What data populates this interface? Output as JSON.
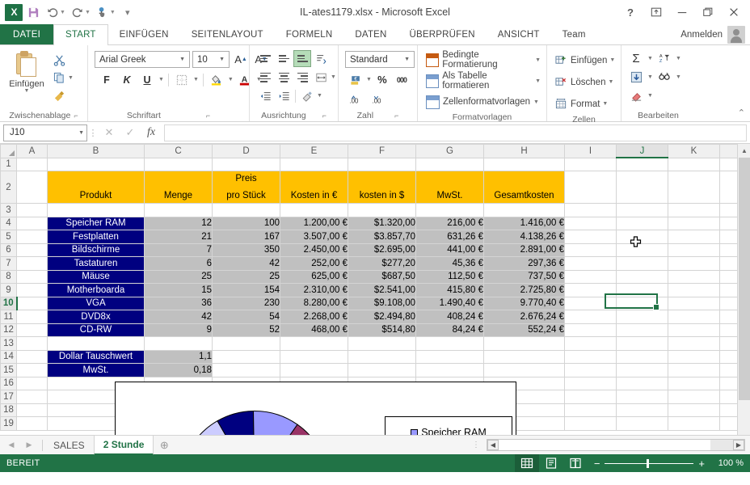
{
  "window": {
    "title": "IL-ates1179.xlsx - Microsoft Excel",
    "help": "?",
    "ribbon_display": "ribbon-display-icon",
    "minimize": "minimize-icon",
    "restore": "restore-icon",
    "close": "close-icon"
  },
  "quick_access": {
    "logo": "excel-logo",
    "save": "save-icon",
    "undo": "undo-icon",
    "redo": "redo-icon",
    "touch": "touch-mode-icon",
    "more": "customize-qat-icon"
  },
  "tabs": [
    {
      "label": "DATEI",
      "type": "file"
    },
    {
      "label": "START",
      "active": true
    },
    {
      "label": "EINFÜGEN"
    },
    {
      "label": "SEITENLAYOUT"
    },
    {
      "label": "FORMELN"
    },
    {
      "label": "DATEN"
    },
    {
      "label": "ÜBERPRÜFEN"
    },
    {
      "label": "ANSICHT"
    },
    {
      "label": "Team"
    }
  ],
  "signin": {
    "label": "Anmelden"
  },
  "ribbon": {
    "clipboard": {
      "group_label": "Zwischenablage",
      "paste_label": "Einfügen",
      "cut": "scissors-icon",
      "copy": "copy-icon",
      "format_painter": "format-painter-icon"
    },
    "font": {
      "group_label": "Schriftart",
      "font_name": "Arial Greek",
      "font_size": "10",
      "grow": "A",
      "shrink": "A",
      "bold": "F",
      "italic": "K",
      "underline": "U",
      "borders": "borders-icon",
      "fill_color": "fill-color-icon",
      "font_color": "A"
    },
    "alignment": {
      "group_label": "Ausrichtung",
      "align_top": "align-top-icon",
      "align_middle": "align-middle-icon",
      "align_bottom": "align-bottom-icon",
      "orientation": "orientation-icon",
      "align_left": "align-left-icon",
      "align_center": "align-center-icon",
      "align_right": "align-right-icon",
      "wrap_text": "wrap-text-icon",
      "decrease_indent": "decrease-indent-icon",
      "increase_indent": "increase-indent-icon",
      "merge": "merge-cells-icon"
    },
    "number": {
      "group_label": "Zahl",
      "format": "Standard",
      "currency": "currency-icon",
      "percent": "%",
      "comma": "000",
      "increase_decimal": "increase-decimal-icon",
      "decrease_decimal": "decrease-decimal-icon"
    },
    "styles": {
      "group_label": "Formatvorlagen",
      "items": [
        {
          "label": "Bedingte Formatierung"
        },
        {
          "label": "Als Tabelle formatieren"
        },
        {
          "label": "Zellenformatvorlagen"
        }
      ]
    },
    "cells": {
      "group_label": "Zellen",
      "items": [
        {
          "label": "Einfügen"
        },
        {
          "label": "Löschen"
        },
        {
          "label": "Format"
        }
      ]
    },
    "editing": {
      "group_label": "Bearbeiten",
      "autosum": "Σ",
      "fill": "fill-down-icon",
      "clear": "clear-icon",
      "sort": "sort-filter-icon",
      "find": "find-select-icon"
    },
    "collapse": "collapse-ribbon-icon"
  },
  "formula_bar": {
    "name_box": "J10",
    "cancel": "cancel-icon",
    "enter": "enter-icon",
    "insert_function": "fx",
    "formula_value": ""
  },
  "grid": {
    "columns": [
      "A",
      "B",
      "C",
      "D",
      "E",
      "F",
      "G",
      "H",
      "I",
      "J",
      "K",
      "L"
    ],
    "selected_column": "J",
    "selected_row": "10",
    "rows": [
      "1",
      "2",
      "3",
      "4",
      "5",
      "6",
      "7",
      "8",
      "9",
      "10",
      "11",
      "12",
      "13",
      "14",
      "15",
      "16",
      "17",
      "18",
      "19"
    ],
    "headers": {
      "title_line1": "Preis",
      "B": "Produkt",
      "C": "Menge",
      "D": "pro Stück",
      "E": "Kosten in €",
      "F": "kosten in $",
      "G": "MwSt.",
      "H": "Gesamtkosten"
    },
    "data": [
      {
        "row": "4",
        "produkt": "Speicher RAM",
        "menge": "12",
        "preis": "100",
        "kosten_eur": "1.200,00 €",
        "kosten_usd": "$1.320,00",
        "mwst": "216,00 €",
        "gesamt": "1.416,00 €"
      },
      {
        "row": "5",
        "produkt": "Festplatten",
        "menge": "21",
        "preis": "167",
        "kosten_eur": "3.507,00 €",
        "kosten_usd": "$3.857,70",
        "mwst": "631,26 €",
        "gesamt": "4.138,26 €"
      },
      {
        "row": "6",
        "produkt": "Bildschirme",
        "menge": "7",
        "preis": "350",
        "kosten_eur": "2.450,00 €",
        "kosten_usd": "$2.695,00",
        "mwst": "441,00 €",
        "gesamt": "2.891,00 €"
      },
      {
        "row": "7",
        "produkt": "Tastaturen",
        "menge": "6",
        "preis": "42",
        "kosten_eur": "252,00 €",
        "kosten_usd": "$277,20",
        "mwst": "45,36 €",
        "gesamt": "297,36 €"
      },
      {
        "row": "8",
        "produkt": "Mäuse",
        "menge": "25",
        "preis": "25",
        "kosten_eur": "625,00 €",
        "kosten_usd": "$687,50",
        "mwst": "112,50 €",
        "gesamt": "737,50 €"
      },
      {
        "row": "9",
        "produkt": "Motherboarda",
        "menge": "15",
        "preis": "154",
        "kosten_eur": "2.310,00 €",
        "kosten_usd": "$2.541,00",
        "mwst": "415,80 €",
        "gesamt": "2.725,80 €"
      },
      {
        "row": "10",
        "produkt": "VGA",
        "menge": "36",
        "preis": "230",
        "kosten_eur": "8.280,00 €",
        "kosten_usd": "$9.108,00",
        "mwst": "1.490,40 €",
        "gesamt": "9.770,40 €"
      },
      {
        "row": "11",
        "produkt": "DVD8x",
        "menge": "42",
        "preis": "54",
        "kosten_eur": "2.268,00 €",
        "kosten_usd": "$2.494,80",
        "mwst": "408,24 €",
        "gesamt": "2.676,24 €"
      },
      {
        "row": "12",
        "produkt": "CD-RW",
        "menge": "9",
        "preis": "52",
        "kosten_eur": "468,00 €",
        "kosten_usd": "$514,80",
        "mwst": "84,24 €",
        "gesamt": "552,24 €"
      }
    ],
    "params": [
      {
        "row": "14",
        "label": "Dollar Tauschwert",
        "value": "1,1"
      },
      {
        "row": "15",
        "label": "MwSt.",
        "value": "0,18"
      }
    ],
    "cursor": "cross-cursor"
  },
  "chart_data": {
    "type": "pie",
    "title": "",
    "legend_position": "right",
    "legend_entries": [
      "Speicher RAM"
    ],
    "categories": [
      "Speicher RAM",
      "Festplatten",
      "Bildschirme",
      "Tastaturen",
      "Mäuse",
      "Motherboarda",
      "VGA",
      "DVD8x",
      "CD-RW"
    ],
    "values": [
      1416.0,
      4138.26,
      2891.0,
      297.36,
      737.5,
      2725.8,
      9770.4,
      2676.24,
      552.24
    ],
    "colors": [
      "#9999FF",
      "#993366",
      "#FFFFCC",
      "#CCFFFF",
      "#660066",
      "#FF8080",
      "#0066CC",
      "#CCCCFF",
      "#000080"
    ],
    "visible_slice_colors": [
      "#CCCCFF",
      "#000080",
      "#9999FF",
      "#993366"
    ]
  },
  "sheet_tabs": {
    "prev": "prev-sheet-icon",
    "next": "next-sheet-icon",
    "tabs": [
      {
        "label": "SALES",
        "active": false
      },
      {
        "label": "2 Stunde",
        "active": true
      }
    ],
    "add": "add-sheet-icon"
  },
  "status_bar": {
    "status": "BEREIT",
    "view_normal": "normal-view-icon",
    "view_layout": "page-layout-icon",
    "view_break": "page-break-icon",
    "zoom_out": "−",
    "zoom_in": "+",
    "zoom_level": "100 %"
  },
  "colors": {
    "excel_green": "#217346",
    "header_gold": "#FFC000",
    "label_navy": "#000080",
    "data_gray": "#C0C0C0"
  }
}
